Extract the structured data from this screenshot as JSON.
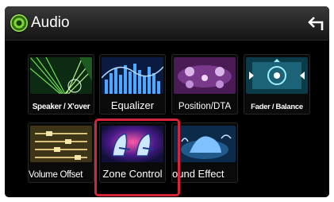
{
  "header": {
    "title": "Audio",
    "back_icon": "back-arrow-icon",
    "audio_icon": "speaker-icon"
  },
  "tiles": [
    {
      "label": "Speaker / X'over",
      "icon": "speaker-crossover-icon"
    },
    {
      "label": "Equalizer",
      "icon": "equalizer-icon"
    },
    {
      "label": "Position/DTA",
      "icon": "position-dta-icon"
    },
    {
      "label": "Fader / Balance",
      "icon": "fader-balance-icon"
    },
    {
      "label": "Volume Offset",
      "icon": "volume-offset-icon"
    },
    {
      "label": "Zone Control",
      "icon": "zone-control-icon",
      "selected": true
    },
    {
      "label": "ound Effect",
      "icon": "sound-effect-icon"
    }
  ],
  "highlight_color": "#d8243a"
}
